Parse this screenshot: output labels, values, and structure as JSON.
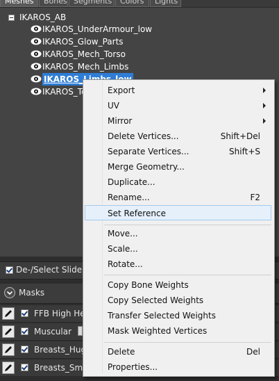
{
  "tabs": [
    {
      "label": "Meshes",
      "active": true
    },
    {
      "label": "Bones",
      "active": false
    },
    {
      "label": "Segments",
      "active": false
    },
    {
      "label": "Colors",
      "active": false
    },
    {
      "label": "Lights",
      "active": false
    }
  ],
  "tree": {
    "root": "IKAROS_AB",
    "nodes": [
      {
        "label": "IKAROS_UnderArmour_low",
        "icon": "eye-icon"
      },
      {
        "label": "IKAROS_Glow_Parts",
        "icon": "eye-icon"
      },
      {
        "label": "IKAROS_Mech_Torso",
        "icon": "eye-icon"
      },
      {
        "label": "IKAROS_Mech_Limbs",
        "icon": "eye-icon"
      },
      {
        "label": "IKAROS_Limbs_low",
        "icon": "eye-icon",
        "selected": true
      },
      {
        "label": "IKAROS_To",
        "icon": "eye-icon"
      }
    ]
  },
  "sliders_bar": {
    "label": "De-/Select Sliders",
    "checked": true
  },
  "masks_bar": {
    "label": "Masks"
  },
  "slider_rows": [
    {
      "label": "FFB High Hee",
      "checked": true,
      "thumb": false
    },
    {
      "label": "Muscular",
      "checked": true,
      "thumb": true
    },
    {
      "label": "Breasts_Huge",
      "checked": true,
      "thumb": false
    },
    {
      "label": "Breasts_Small",
      "checked": true,
      "thumb": false
    }
  ],
  "context_menu": {
    "groups": [
      [
        {
          "label": "Export",
          "submenu": true
        },
        {
          "label": "UV",
          "submenu": true
        },
        {
          "label": "Mirror",
          "submenu": true
        },
        {
          "label": "Delete Vertices...",
          "shortcut": "Shift+Del"
        },
        {
          "label": "Separate Vertices...",
          "shortcut": "Shift+S"
        },
        {
          "label": "Merge Geometry..."
        },
        {
          "label": "Duplicate..."
        },
        {
          "label": "Rename...",
          "shortcut": "F2"
        },
        {
          "label": "Set Reference",
          "hover": true
        }
      ],
      [
        {
          "label": "Move..."
        },
        {
          "label": "Scale..."
        },
        {
          "label": "Rotate..."
        }
      ],
      [
        {
          "label": "Copy Bone Weights"
        },
        {
          "label": "Copy Selected Weights"
        },
        {
          "label": "Transfer Selected Weights"
        },
        {
          "label": "Mask Weighted Vertices"
        }
      ],
      [
        {
          "label": "Delete",
          "shortcut": "Del"
        },
        {
          "label": "Properties..."
        }
      ]
    ]
  }
}
